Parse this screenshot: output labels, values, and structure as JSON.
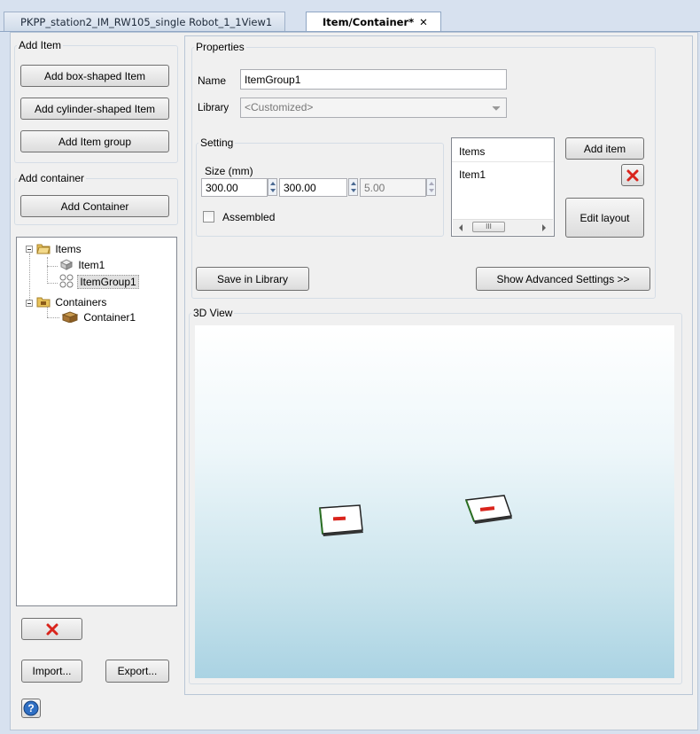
{
  "tabs": [
    {
      "label": "PKPP_station2_IM_RW105_single Robot_1_1View1",
      "active": false
    },
    {
      "label": "Item/Container*",
      "active": true,
      "close": "✕"
    }
  ],
  "add_item": {
    "legend": "Add Item",
    "box_button": "Add box-shaped Item",
    "cylinder_button": "Add cylinder-shaped Item",
    "group_button": "Add Item group"
  },
  "add_container": {
    "legend": "Add container",
    "button": "Add Container"
  },
  "tree": {
    "items_label": "Items",
    "children_items": [
      "Item1",
      "ItemGroup1"
    ],
    "containers_label": "Containers",
    "children_containers": [
      "Container1"
    ],
    "selected": "ItemGroup1"
  },
  "left_bottom": {
    "import_button": "Import...",
    "export_button": "Export..."
  },
  "properties": {
    "legend": "Properties",
    "name_label": "Name",
    "name_value": "ItemGroup1",
    "library_label": "Library",
    "library_value": "<Customized>",
    "setting": {
      "legend": "Setting",
      "size_label": "Size (mm)",
      "size_x": "300.00",
      "size_y": "300.00",
      "size_z": "5.00",
      "assembled_label": "Assembled",
      "assembled_checked": false
    },
    "items_list": {
      "header": "Items",
      "rows": [
        "Item1"
      ],
      "scroll_thumb": "III"
    },
    "add_item_button": "Add item",
    "edit_layout_button": "Edit layout",
    "save_library_button": "Save in Library",
    "advanced_button": "Show Advanced Settings >>"
  },
  "view3d": {
    "legend": "3D View"
  },
  "colors": {
    "delete_red": "#d9241c",
    "selection": "#e1e1e1",
    "folder": "#e8c35a"
  }
}
